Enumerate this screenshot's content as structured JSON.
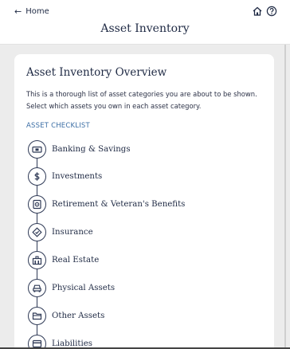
{
  "nav": {
    "back_label": "Home",
    "title": "Asset Inventory",
    "icons": [
      "home-icon",
      "help-icon"
    ]
  },
  "card": {
    "heading": "Asset Inventory Overview",
    "intro": "This is a thorough list of asset categories you are about to be shown. Select which assets you own in each asset category.",
    "checklist_label": "ASSET CHECKLIST",
    "items": [
      {
        "label": "Banking & Savings",
        "icon": "cash-icon"
      },
      {
        "label": "Investments",
        "icon": "dollar-icon"
      },
      {
        "label": "Retirement & Veteran's Benefits",
        "icon": "safe-icon"
      },
      {
        "label": "Insurance",
        "icon": "shield-tag-icon"
      },
      {
        "label": "Real Estate",
        "icon": "building-icon"
      },
      {
        "label": "Physical Assets",
        "icon": "car-icon"
      },
      {
        "label": "Other Assets",
        "icon": "folder-icon"
      },
      {
        "label": "Liabilities",
        "icon": "card-icon"
      }
    ]
  },
  "colors": {
    "primary": "#1f2a44",
    "accent": "#3b6ea5",
    "background": "#ececec"
  }
}
